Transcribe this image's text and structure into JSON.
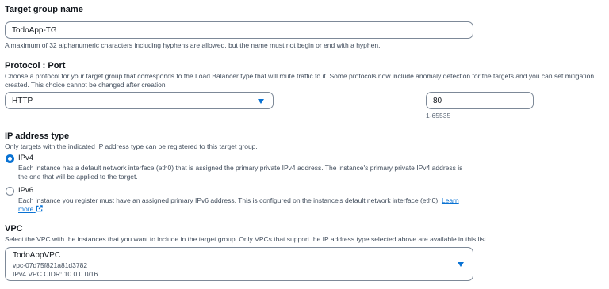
{
  "target_group_name": {
    "label": "Target group name",
    "value": "TodoApp-TG",
    "hint": "A maximum of 32 alphanumeric characters including hyphens are allowed, but the name must not begin or end with a hyphen."
  },
  "protocol_port": {
    "label": "Protocol : Port",
    "description": "Choose a protocol for your target group that corresponds to the Load Balancer type that will route traffic to it. Some protocols now include anomaly detection for the targets and you can set mitigation created. This choice cannot be changed after creation",
    "protocol_value": "HTTP",
    "port_value": "80",
    "port_hint": "1-65535"
  },
  "ip_address_type": {
    "label": "IP address type",
    "description": "Only targets with the indicated IP address type can be registered to this target group.",
    "options": [
      {
        "label": "IPv4",
        "checked": true,
        "description": "Each instance has a default network interface (eth0) that is assigned the primary private IPv4 address. The instance's primary private IPv4 address is the one that will be applied to the target."
      },
      {
        "label": "IPv6",
        "checked": false,
        "description": "Each instance you register must have an assigned primary IPv6 address. This is configured on the instance's default network interface (eth0).",
        "link_text": "Learn more"
      }
    ]
  },
  "vpc": {
    "label": "VPC",
    "description": "Select the VPC with the instances that you want to include in the target group. Only VPCs that support the IP address type selected above are available in this list.",
    "selected_name": "TodoAppVPC",
    "selected_id": "vpc-07d75f821a81d3782",
    "selected_cidr": "IPv4 VPC CIDR: 10.0.0.0/16"
  },
  "colors": {
    "accent": "#0972d3",
    "border": "#7d8998",
    "text": "#0f141a",
    "muted": "#414d5c"
  },
  "icons": {
    "dropdown": "caret-down-icon",
    "external_link": "external-link-icon"
  }
}
